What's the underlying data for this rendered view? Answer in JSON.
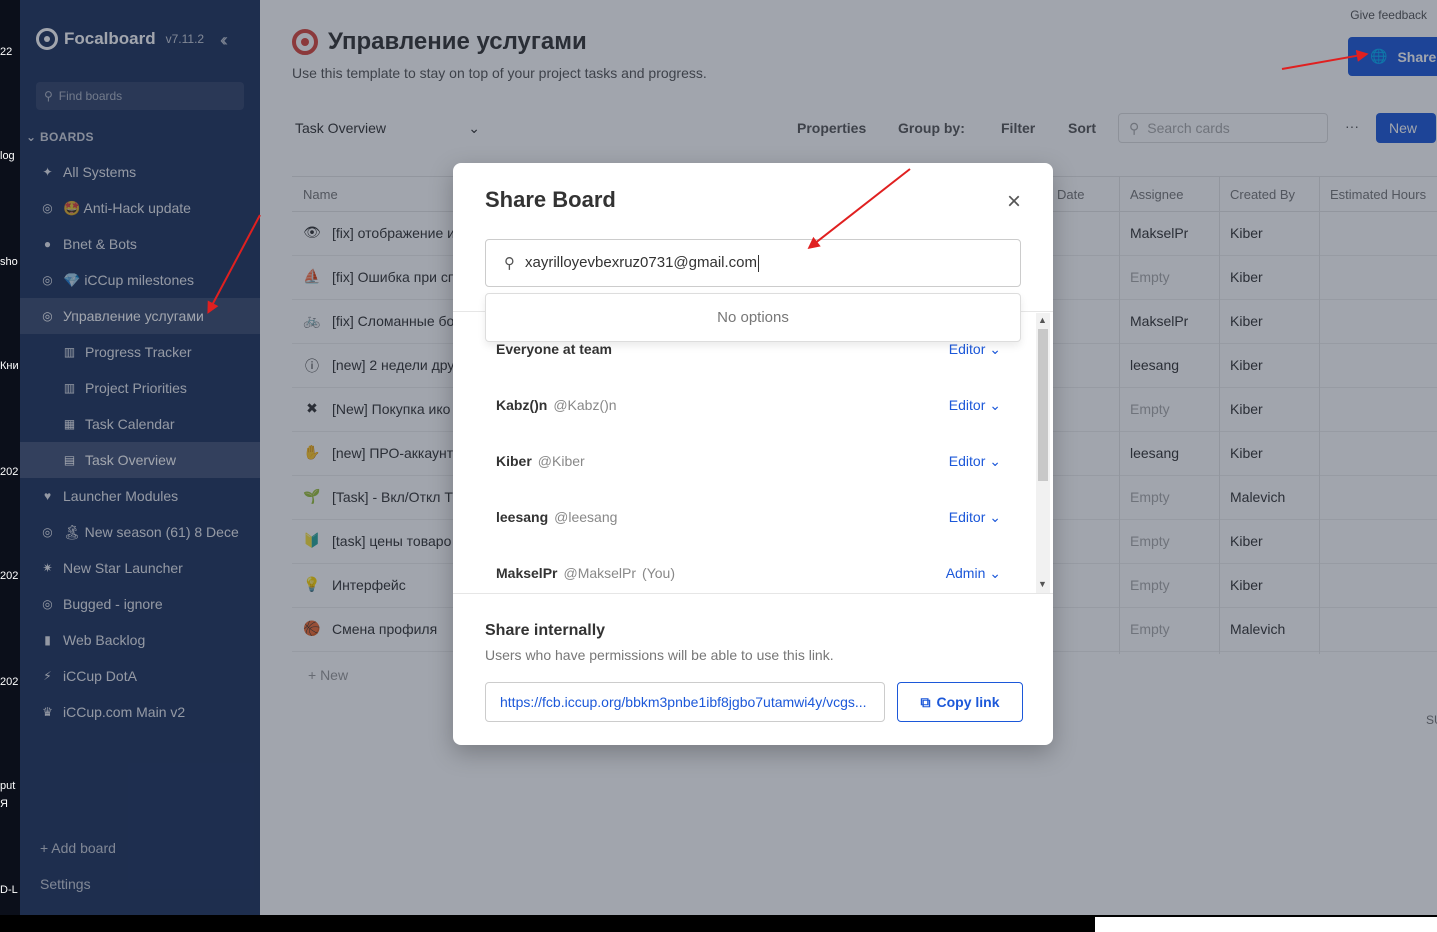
{
  "desktop": {
    "labels": [
      "22",
      "log",
      "sho",
      "Кни",
      "202",
      "202",
      "202",
      "put",
      "Я",
      "D-L"
    ]
  },
  "sidebar": {
    "app_name": "Focalboard",
    "version": "v7.11.2",
    "search_placeholder": "Find boards",
    "section_label": "BOARDS",
    "items": [
      {
        "label": "All Systems",
        "icon": "puzzle-icon",
        "glyph": "✦"
      },
      {
        "label": "🤩 Anti-Hack update",
        "icon": "target-icon",
        "glyph": "◎"
      },
      {
        "label": "Bnet & Bots",
        "icon": "globe-icon",
        "glyph": "●"
      },
      {
        "label": "💎 iCCup milestones",
        "icon": "target-icon",
        "glyph": "◎"
      },
      {
        "label": "Управление услугами",
        "icon": "target-icon",
        "glyph": "◎",
        "active": true
      },
      {
        "label": "Progress Tracker",
        "icon": "board-icon",
        "glyph": "▥",
        "view": true
      },
      {
        "label": "Project Priorities",
        "icon": "board-icon",
        "glyph": "▥",
        "view": true
      },
      {
        "label": "Task Calendar",
        "icon": "calendar-icon",
        "glyph": "▦",
        "view": true
      },
      {
        "label": "Task Overview",
        "icon": "table-icon",
        "glyph": "▤",
        "view": true,
        "active": true
      },
      {
        "label": "Launcher Modules",
        "icon": "heart-icon",
        "glyph": "♥"
      },
      {
        "label": "🏝 New season (61) 8 Dece",
        "icon": "target-icon",
        "glyph": "◎"
      },
      {
        "label": "New Star Launcher",
        "icon": "star-icon",
        "glyph": "✷"
      },
      {
        "label": "Bugged - ignore",
        "icon": "target-icon",
        "glyph": "◎"
      },
      {
        "label": "Web Backlog",
        "icon": "book-icon",
        "glyph": "▮"
      },
      {
        "label": "iCCup DotA",
        "icon": "lightning-icon",
        "glyph": "⚡"
      },
      {
        "label": "iCCup.com Main v2",
        "icon": "trophy-icon",
        "glyph": "♛"
      }
    ],
    "add_board": "+ Add board",
    "settings": "Settings"
  },
  "main": {
    "feedback": "Give feedback",
    "title": "Управление услугами",
    "description": "Use this template to stay on top of your project tasks and progress.",
    "share_label": "Share",
    "view_name": "Task Overview",
    "toolbar": {
      "properties": "Properties",
      "group_by": "Group by:",
      "filter": "Filter",
      "sort": "Sort",
      "search_placeholder": "Search cards",
      "more": "···",
      "new": "New"
    },
    "columns": [
      "Name",
      "Date",
      "Assignee",
      "Created By",
      "Estimated Hours"
    ],
    "rows": [
      {
        "icon": "👁",
        "name": "[fix] отображение и",
        "assignee": "MakselPr",
        "created_by": "Kiber"
      },
      {
        "icon": "⛵",
        "name": "[fix] Ошибка при сп",
        "assignee": "Empty",
        "created_by": "Kiber"
      },
      {
        "icon": "🚲",
        "name": "[fix] Сломанные бо",
        "assignee": "MakselPr",
        "created_by": "Kiber"
      },
      {
        "icon": "ⓘ",
        "name": "[new] 2 недели дру",
        "assignee": "leesang",
        "created_by": "Kiber"
      },
      {
        "icon": "✖",
        "name": "[New] Покупка ико",
        "assignee": "Empty",
        "created_by": "Kiber"
      },
      {
        "icon": "✋",
        "name": "[new] ПРО-аккаунт",
        "assignee": "leesang",
        "created_by": "Kiber"
      },
      {
        "icon": "🌱",
        "name": "[Task] - Вкл/Откл Т",
        "assignee": "Empty",
        "created_by": "Malevich"
      },
      {
        "icon": "🔰",
        "name": "[task] цены товаро",
        "assignee": "Empty",
        "created_by": "Kiber"
      },
      {
        "icon": "💡",
        "name": "Интерфейс",
        "assignee": "Empty",
        "created_by": "Kiber"
      },
      {
        "icon": "🏀",
        "name": "Смена профиля",
        "assignee": "Empty",
        "created_by": "Malevich"
      }
    ],
    "add_new": "+ New",
    "sum_label": "SUM"
  },
  "modal": {
    "title": "Share Board",
    "input_value": "xayrilloyevbexruz0731@gmail.com",
    "no_options": "No options",
    "users": [
      {
        "name": "Everyone at team",
        "handle": "",
        "you": "",
        "role": "Editor"
      },
      {
        "name": "Kabz()n",
        "handle": "@Kabz()n",
        "you": "",
        "role": "Editor"
      },
      {
        "name": "Kiber",
        "handle": "@Kiber",
        "you": "",
        "role": "Editor"
      },
      {
        "name": "leesang",
        "handle": "@leesang",
        "you": "",
        "role": "Editor"
      },
      {
        "name": "MakselPr",
        "handle": "@MakselPr",
        "you": "(You)",
        "role": "Admin"
      }
    ],
    "share_internally_title": "Share internally",
    "share_internally_desc": "Users who have permissions will be able to use this link.",
    "link": "https://fcb.iccup.org/bbkm3pnbe1ibf8jgbo7utamwi4y/vcgs...",
    "copy_label": "Copy link"
  },
  "colors": {
    "sidebar_bg": "#1e325c",
    "accent": "#1c58d9",
    "annotation": "#e02020"
  }
}
